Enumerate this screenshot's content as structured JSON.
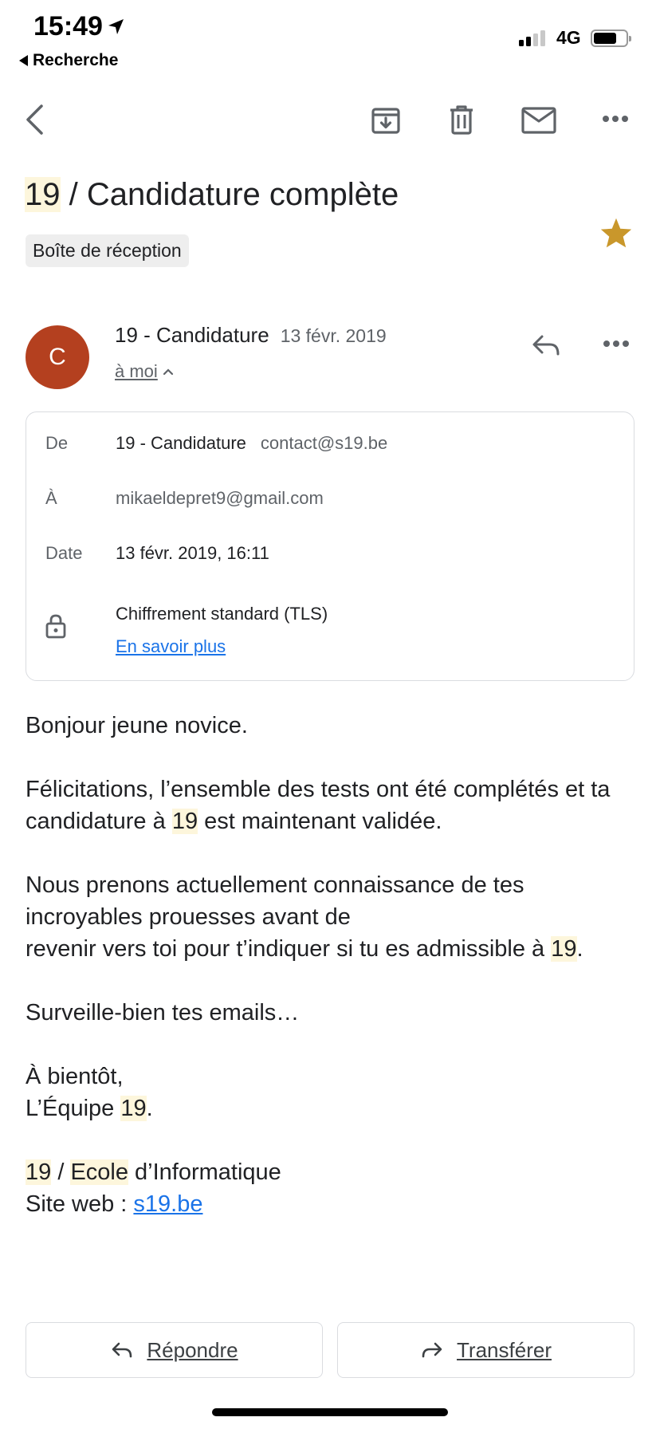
{
  "status_bar": {
    "time": "15:49",
    "back_app": "Recherche",
    "network": "4G"
  },
  "toolbar": {
    "icons": [
      "back-arrow-icon",
      "archive-icon",
      "trash-icon",
      "mail-icon",
      "more-icon"
    ]
  },
  "email": {
    "subject_tag": "19",
    "subject_rest": " / Candidature complète",
    "label": "Boîte de réception",
    "starred": true,
    "sender_initial": "C",
    "sender_name": "19 - Candidature",
    "date_short": "13 févr. 2019",
    "to_me": "à moi"
  },
  "details": {
    "from_label": "De",
    "from_name": "19 - Candidature",
    "from_email": "contact@s19.be",
    "to_label": "À",
    "to_email": "mikaeldepret9@gmail.com",
    "date_label": "Date",
    "date_value": "13 févr. 2019, 16:11",
    "encryption": "Chiffrement standard (TLS)",
    "learn_more": "En savoir plus"
  },
  "body": {
    "greeting": "Bonjour jeune novice.",
    "p2_a": "Félicitations, l’ensemble des tests ont été complétés et ta candidature à ",
    "p2_hl": "19",
    "p2_b": " est maintenant validée.",
    "p3_a": "Nous prenons actuellement connaissance de tes incroyables prouesses avant de",
    "p3_b": "revenir vers toi pour t’indiquer si tu es admissible à ",
    "p3_hl": "19",
    "p3_c": ".",
    "p4": "Surveille-bien tes emails…",
    "sign_1": "À bientôt,",
    "sign_2a": "L’Équipe ",
    "sign_2hl": "19",
    "sign_2b": ".",
    "footer_hl1": "19",
    "footer_sep": " / ",
    "footer_hl2": "Ecole",
    "footer_rest": " d’Informatique",
    "site_label": "Site web : ",
    "site_link": "s19.be"
  },
  "actions": {
    "reply": "Répondre",
    "forward": "Transférer"
  },
  "colors": {
    "highlight": "#fdf6dc",
    "avatar": "#b4401f",
    "star": "#c9972b",
    "link": "#1a73e8"
  }
}
